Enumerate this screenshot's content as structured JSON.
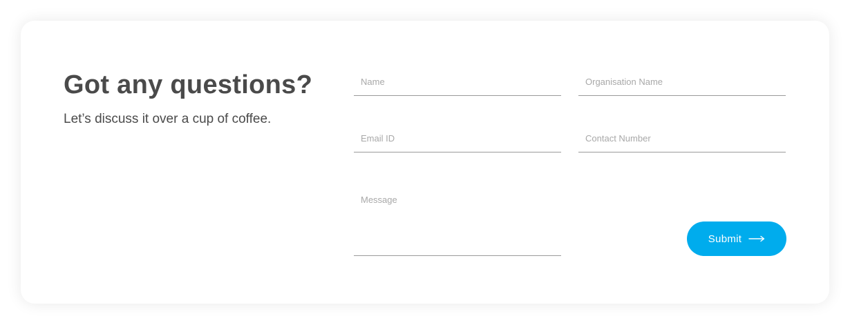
{
  "intro": {
    "title": "Got any questions?",
    "subtitle": "Let’s discuss it over a cup of coffee."
  },
  "form": {
    "name_placeholder": "Name",
    "organisation_placeholder": "Organisation Name",
    "email_placeholder": "Email ID",
    "contact_placeholder": "Contact Number",
    "message_placeholder": "Message",
    "submit_label": "Submit",
    "submit_icon": "long-arrow-right-icon"
  },
  "colors": {
    "accent": "#00aced",
    "text": "#4a4a4a",
    "placeholder": "#a8a8a8",
    "underline": "#9a9a9a"
  }
}
